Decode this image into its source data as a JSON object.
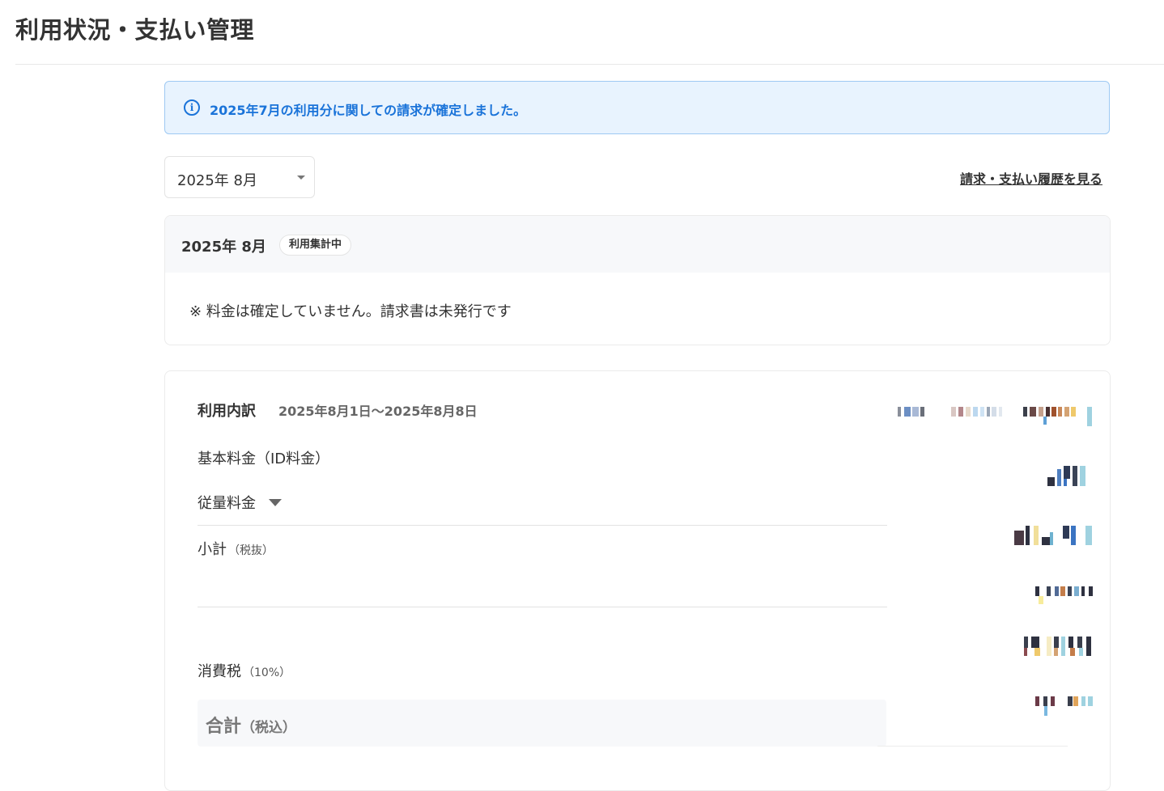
{
  "page": {
    "title": "利用状況・支払い管理"
  },
  "notice": {
    "icon": "info-icon",
    "text": "2025年7月の利用分に関しての請求が確定しました。",
    "color": "#1a73d9",
    "background": "#e8f3fe"
  },
  "controls": {
    "month_select_value": "2025年 8月",
    "history_link": "請求・支払い履歴を見る"
  },
  "status": {
    "month": "2025年 8月",
    "badge": "利用集計中",
    "note": "※ 料金は確定していません。請求書は未発行です"
  },
  "breakdown": {
    "title": "利用内訳",
    "period": "2025年8月1日〜2025年8月8日",
    "rows": {
      "base_fee": "基本料金（ID料金）",
      "usage_fee": "従量料金",
      "subtotal": "小計",
      "subtotal_note": "（税抜）",
      "tax": "消費税",
      "tax_rate": "（10%）",
      "total": "合計",
      "total_note": "（税込）"
    },
    "values_redacted": true
  }
}
